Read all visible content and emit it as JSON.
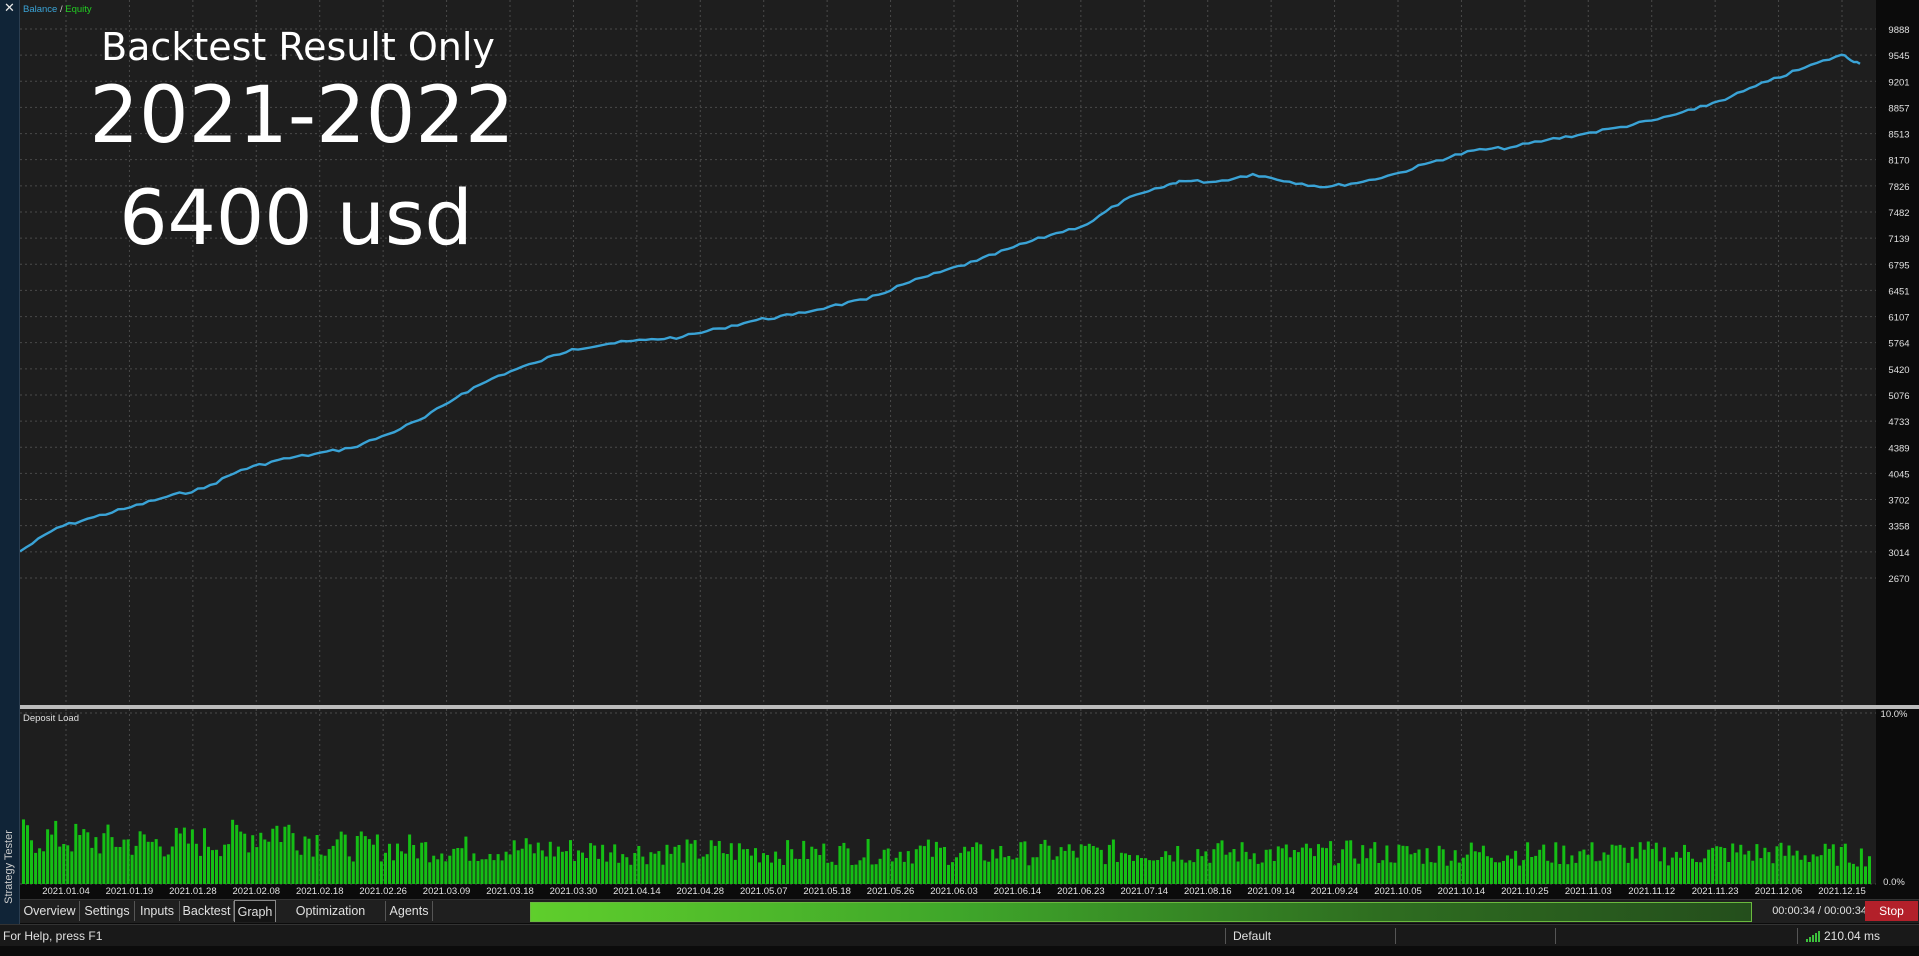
{
  "side_panel": {
    "close_glyph": "✕",
    "title": "Strategy Tester"
  },
  "overlay": {
    "line1": "Backtest Result Only",
    "line2": "2021-2022",
    "line3": "6400 usd"
  },
  "colors": {
    "background": "#1e1e1e",
    "grid": "#4a4a4a",
    "balance": "#3aa3d6",
    "equity": "#00c000",
    "deposit_load": "#15bf15",
    "stop_button": "#b3202a"
  },
  "chart_data": [
    {
      "type": "line",
      "legend": [
        "Balance",
        "Equity"
      ],
      "legend_separator": " / ",
      "legend_placement": "top-left",
      "grid": true,
      "y_ticks": [
        "9888",
        "9545",
        "9201",
        "8857",
        "8513",
        "8170",
        "7826",
        "7482",
        "7139",
        "6795",
        "6451",
        "6107",
        "5764",
        "5420",
        "5076",
        "4733",
        "4389",
        "4045",
        "3702",
        "3358",
        "3014",
        "2670"
      ],
      "ylim": [
        2670,
        9888
      ],
      "xlim": [
        0,
        1
      ],
      "series": [
        {
          "name": "Balance",
          "x": [
            0.0,
            0.02,
            0.04,
            0.06,
            0.08,
            0.1,
            0.12,
            0.14,
            0.16,
            0.18,
            0.2,
            0.22,
            0.24,
            0.26,
            0.28,
            0.3,
            0.32,
            0.34,
            0.36,
            0.38,
            0.4,
            0.42,
            0.44,
            0.46,
            0.48,
            0.5,
            0.52,
            0.54,
            0.56,
            0.58,
            0.6,
            0.62,
            0.63,
            0.65,
            0.67,
            0.69,
            0.71,
            0.73,
            0.75,
            0.77,
            0.79,
            0.81,
            0.83,
            0.85,
            0.87,
            0.89,
            0.91,
            0.93,
            0.95,
            0.97,
            0.99,
            1.0
          ],
          "values": [
            3020,
            3330,
            3470,
            3600,
            3740,
            3850,
            4090,
            4220,
            4300,
            4380,
            4560,
            4780,
            5090,
            5330,
            5500,
            5680,
            5750,
            5800,
            5840,
            5950,
            6060,
            6130,
            6240,
            6330,
            6530,
            6690,
            6840,
            7020,
            7180,
            7320,
            7640,
            7800,
            7890,
            7880,
            7980,
            7880,
            7810,
            7880,
            8000,
            8160,
            8290,
            8330,
            8430,
            8510,
            8600,
            8700,
            8830,
            9000,
            9200,
            9380,
            9550,
            9430
          ]
        }
      ]
    },
    {
      "type": "bar",
      "title": "Deposit Load",
      "y_ticks": [
        "10.0%",
        "0.0%"
      ],
      "ylim": [
        0,
        10
      ],
      "x_labels": [
        "2021.01.04",
        "2021.01.19",
        "2021.01.28",
        "2021.02.08",
        "2021.02.18",
        "2021.02.26",
        "2021.03.09",
        "2021.03.18",
        "2021.03.30",
        "2021.04.14",
        "2021.04.28",
        "2021.05.07",
        "2021.05.18",
        "2021.05.26",
        "2021.06.03",
        "2021.06.14",
        "2021.06.23",
        "2021.07.14",
        "2021.08.16",
        "2021.09.14",
        "2021.09.24",
        "2021.10.05",
        "2021.10.14",
        "2021.10.25",
        "2021.11.03",
        "2021.11.12",
        "2021.11.23",
        "2021.12.06",
        "2021.12.15"
      ],
      "values_profile": [
        3.0,
        2.8,
        2.6,
        2.7,
        3.5,
        2.4,
        2.3,
        2.2,
        2.2,
        2.1,
        2.0,
        2.1,
        2.0,
        2.0,
        2.1,
        1.9,
        2.0,
        2.0,
        2.1,
        2.0,
        1.9,
        2.0,
        1.9,
        2.0,
        1.9,
        2.0,
        1.9,
        2.0,
        1.9,
        1.8
      ]
    }
  ],
  "tabs": [
    {
      "label": "Overview",
      "active": false
    },
    {
      "label": "Settings",
      "active": false
    },
    {
      "label": "Inputs",
      "active": false
    },
    {
      "label": "Backtest",
      "active": false
    },
    {
      "label": "Graph",
      "active": true
    },
    {
      "label": "Optimization Results",
      "active": false
    },
    {
      "label": "Agents",
      "active": false
    }
  ],
  "progress": {
    "fraction": 1.0,
    "elapsed": "00:00:34 / 00:00:34"
  },
  "stop_label": "Stop",
  "status": {
    "help": "For Help, press F1",
    "profile": "Default",
    "ping": "210.04 ms"
  }
}
